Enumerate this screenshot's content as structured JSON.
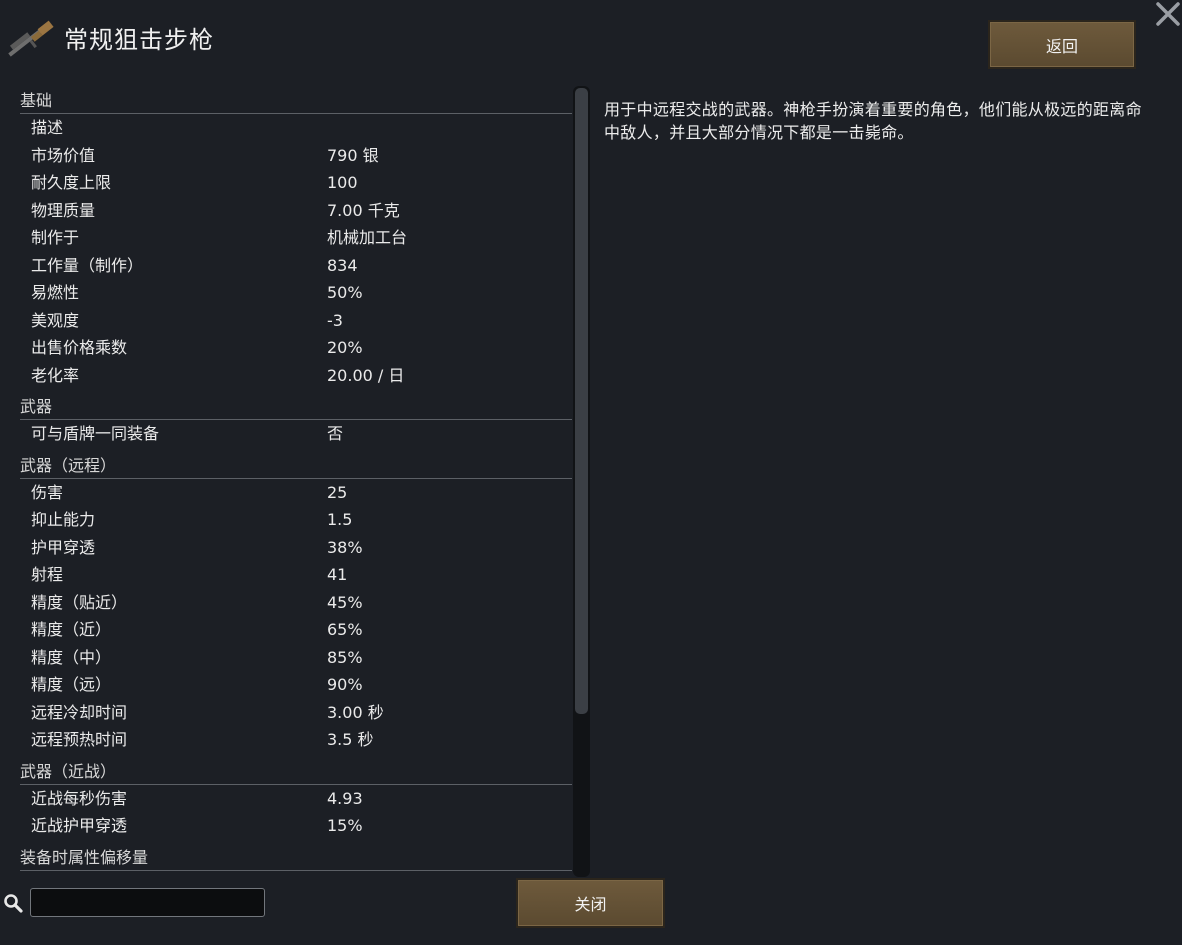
{
  "header": {
    "title": "常规狙击步枪",
    "back_label": "返回"
  },
  "categories": [
    {
      "name": "基础",
      "rows": [
        {
          "label": "描述",
          "value": ""
        },
        {
          "label": "市场价值",
          "value": "790 银"
        },
        {
          "label": "耐久度上限",
          "value": "100"
        },
        {
          "label": "物理质量",
          "value": "7.00 千克"
        },
        {
          "label": "制作于",
          "value": "机械加工台"
        },
        {
          "label": "工作量（制作）",
          "value": "834"
        },
        {
          "label": "易燃性",
          "value": "50%"
        },
        {
          "label": "美观度",
          "value": "-3"
        },
        {
          "label": "出售价格乘数",
          "value": "20%"
        },
        {
          "label": "老化率",
          "value": "20.00 / 日"
        }
      ]
    },
    {
      "name": "武器",
      "rows": [
        {
          "label": "可与盾牌一同装备",
          "value": "否"
        }
      ]
    },
    {
      "name": "武器（远程）",
      "rows": [
        {
          "label": "伤害",
          "value": "25"
        },
        {
          "label": "抑止能力",
          "value": "1.5"
        },
        {
          "label": "护甲穿透",
          "value": "38%"
        },
        {
          "label": "射程",
          "value": "41"
        },
        {
          "label": "精度（贴近）",
          "value": "45%"
        },
        {
          "label": "精度（近）",
          "value": "65%"
        },
        {
          "label": "精度（中）",
          "value": "85%"
        },
        {
          "label": "精度（远）",
          "value": "90%"
        },
        {
          "label": "远程冷却时间",
          "value": "3.00 秒"
        },
        {
          "label": "远程预热时间",
          "value": "3.5 秒"
        }
      ]
    },
    {
      "name": "武器（近战）",
      "rows": [
        {
          "label": "近战每秒伤害",
          "value": "4.93"
        },
        {
          "label": "近战护甲穿透",
          "value": "15%"
        }
      ]
    },
    {
      "name": "装备时属性偏移量",
      "rows": []
    }
  ],
  "description": "用于中远程交战的武器。神枪手扮演着重要的角色，他们能从极远的距离命中敌人，并且大部分情况下都是一击毙命。",
  "footer": {
    "close_label": "关闭",
    "search_value": ""
  },
  "icons": {
    "item": "sniper-rifle-icon",
    "close": "close-x-icon",
    "search": "magnifier-icon"
  },
  "colors": {
    "button": "#6a573a",
    "background": "#1c1f25"
  }
}
